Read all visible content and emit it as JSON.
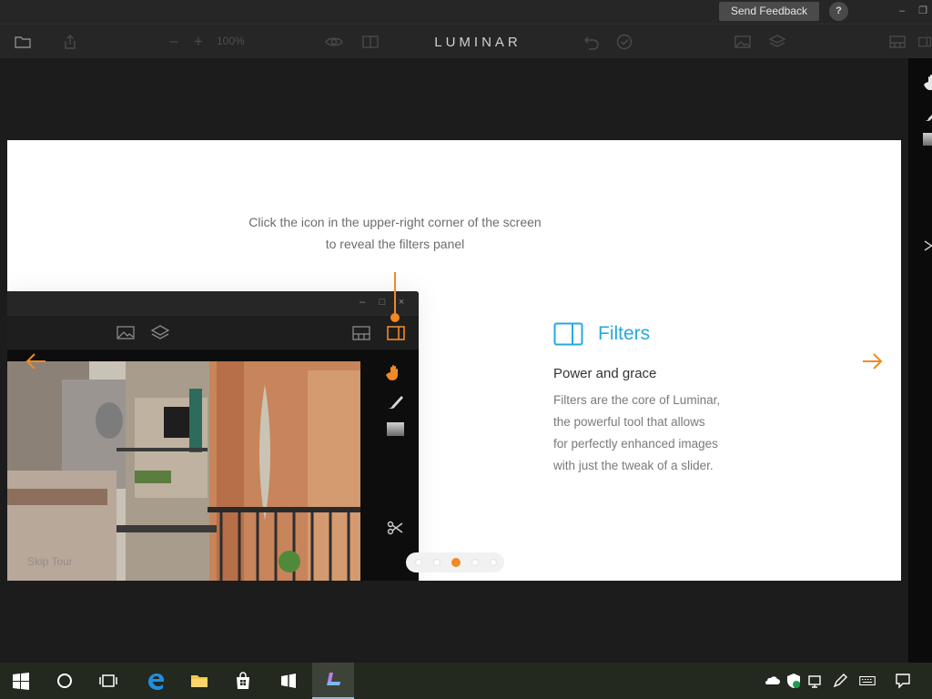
{
  "titlebar": {
    "feedback_label": "Send Feedback",
    "help_label": "?",
    "minimize": "–",
    "restore": "❐"
  },
  "toolbar": {
    "zoom_minus": "–",
    "zoom_plus": "+",
    "zoom_value": "100%",
    "app_title": "LUMINAR"
  },
  "tour": {
    "instruction_line1": "Click the icon in the upper-right corner of the screen",
    "instruction_line2": "to reveal the filters panel",
    "feature_title": "Filters",
    "feature_subtitle": "Power and grace",
    "feature_desc_lines": [
      "Filters are the core of Luminar,",
      "the powerful tool that allows",
      "for perfectly enhanced images",
      "with just the tweak of a slider."
    ],
    "skip_label": "Skip Tour",
    "pager_total": 5,
    "pager_active": 3
  },
  "mini_window": {
    "minimize": "–",
    "maximize": "□",
    "close": "×"
  },
  "colors": {
    "accent_orange": "#f08a24",
    "accent_blue": "#24a9e0"
  },
  "icons": {
    "toolbar": [
      "folder-icon",
      "share-icon",
      "eye-icon",
      "compare-icon",
      "undo-icon",
      "history-icon",
      "image-icon",
      "layers-icon",
      "layout-icon",
      "filters-panel-icon"
    ],
    "right_strip": [
      "hand-icon",
      "brush-icon",
      "gradient-icon",
      "crop-icon"
    ],
    "taskbar": [
      "windows-start-icon",
      "cortana-icon",
      "task-view-icon",
      "edge-icon",
      "file-explorer-icon",
      "store-icon",
      "windows-app-icon",
      "luminar-app-icon"
    ],
    "tray": [
      "onedrive-icon",
      "defender-icon",
      "network-icon",
      "pen-icon",
      "keyboard-icon",
      "notification-icon"
    ]
  }
}
